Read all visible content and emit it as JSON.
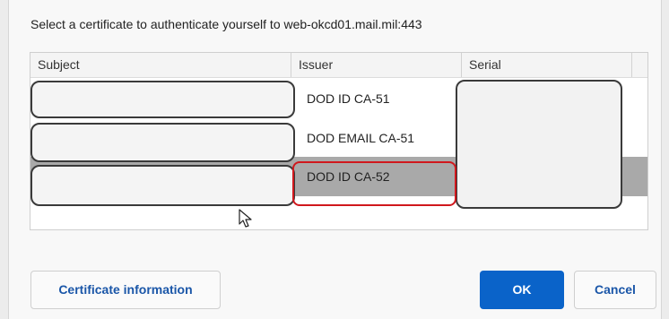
{
  "dialog": {
    "prompt": "Select a certificate to authenticate yourself to web-okcd01.mail.mil:443"
  },
  "table": {
    "columns": [
      "Subject",
      "Issuer",
      "Serial"
    ],
    "rows": [
      {
        "subject": "",
        "issuer": "DOD ID CA-51",
        "serial": ""
      },
      {
        "subject": "",
        "issuer": "DOD EMAIL CA-51",
        "serial": ""
      },
      {
        "subject": "",
        "issuer": "DOD ID CA-52",
        "serial": ""
      }
    ],
    "selected_row_index": 2
  },
  "buttons": {
    "info": "Certificate information",
    "ok": "OK",
    "cancel": "Cancel"
  },
  "colors": {
    "primary": "#0a63c9",
    "link_text": "#1a56a8",
    "selected_row": "#a9a9a9",
    "highlight": "#d0181d"
  }
}
